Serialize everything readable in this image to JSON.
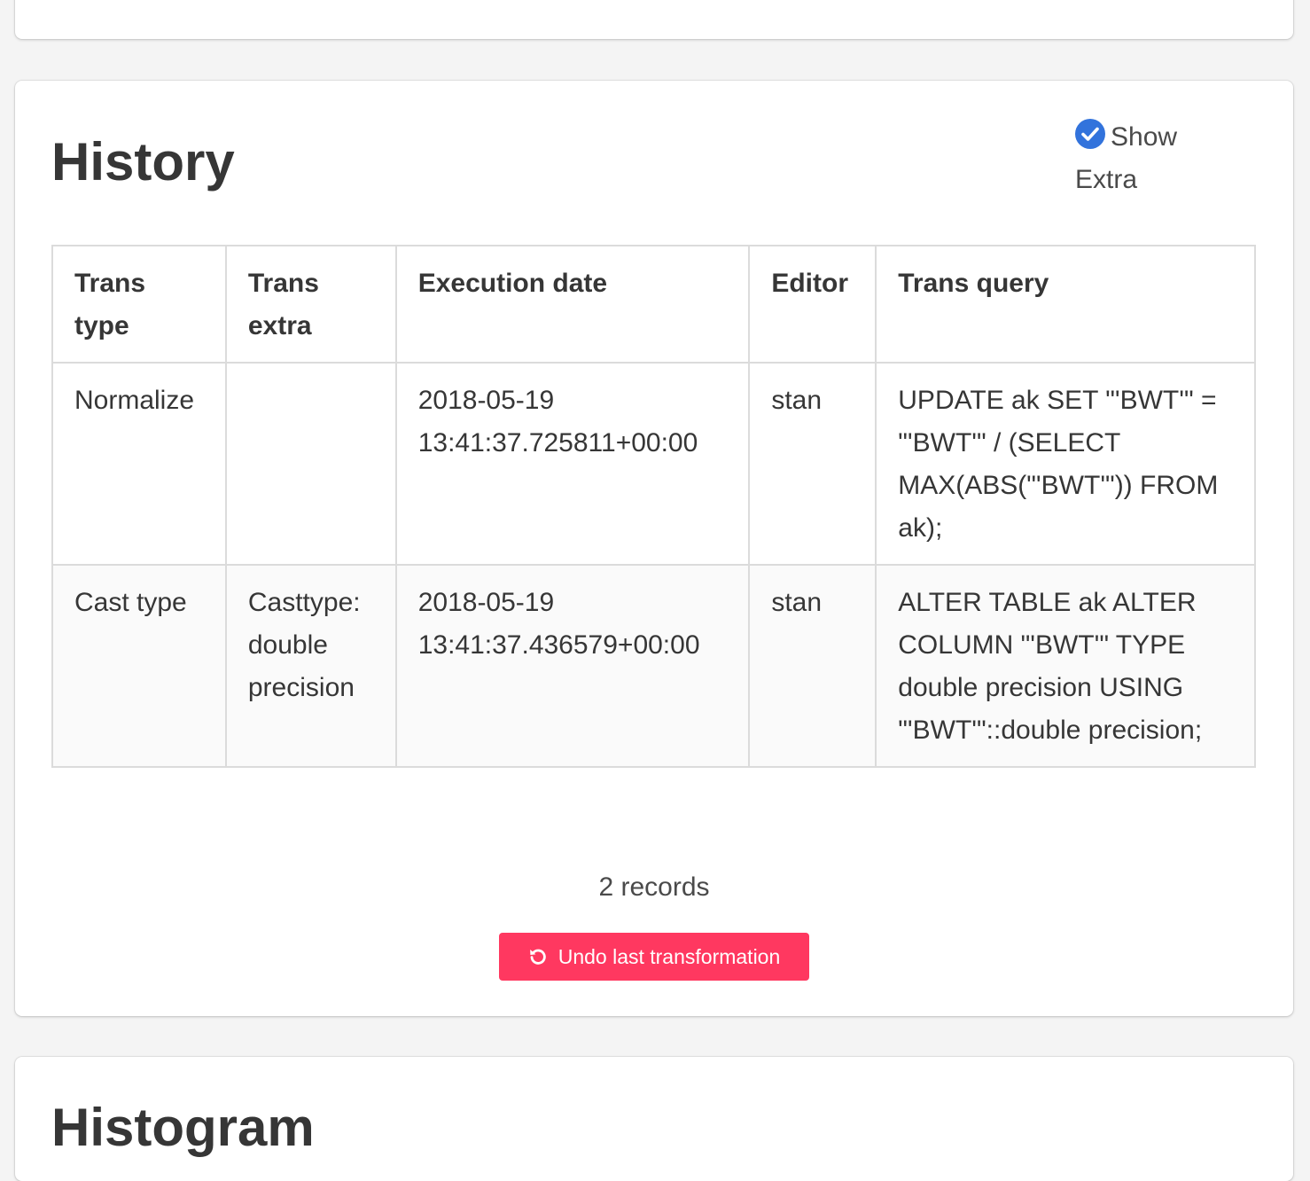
{
  "history": {
    "title": "History",
    "show_extra_label": "Show Extra",
    "show_extra_checked": true,
    "columns": [
      "Trans type",
      "Trans extra",
      "Execution date",
      "Editor",
      "Trans query"
    ],
    "rows": [
      {
        "trans_type": "Normalize",
        "trans_extra": "",
        "execution_date": "2018-05-19 13:41:37.725811+00:00",
        "editor": "stan",
        "trans_query": "UPDATE ak SET \"'BWT'\" = \"'BWT'\" / (SELECT MAX(ABS(\"'BWT'\")) FROM ak);"
      },
      {
        "trans_type": "Cast type",
        "trans_extra": "Casttype: double precision",
        "execution_date": "2018-05-19 13:41:37.436579+00:00",
        "editor": "stan",
        "trans_query": "ALTER TABLE ak ALTER COLUMN \"'BWT'\" TYPE double precision USING \"'BWT'\"::double precision;"
      }
    ],
    "records_label": "2 records",
    "undo_button_label": "Undo last transformation",
    "undo_icon": "undo-icon",
    "check_icon": "check-circle-icon"
  },
  "histogram": {
    "title": "Histogram"
  },
  "colors": {
    "accent_blue": "#3273dc",
    "danger": "#ff3860"
  }
}
